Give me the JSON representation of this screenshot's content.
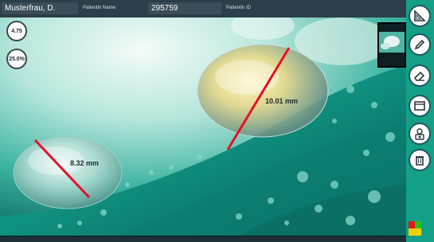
{
  "patient": {
    "name_value": "Musterfrau, D.",
    "name_caption": "Patientin Name",
    "id_value": "295759",
    "id_caption": "Patientin ID"
  },
  "overlay": {
    "zoom_label": "4.75",
    "percent_label": "25.0%"
  },
  "measurements": [
    {
      "label": "8.32 mm",
      "color": "#e8102a"
    },
    {
      "label": "10.01 mm",
      "color": "#e8102a"
    }
  ],
  "toolbar": {
    "tools": [
      {
        "icon": "ruler-triangle-icon"
      },
      {
        "icon": "pencil-icon"
      },
      {
        "icon": "eraser-icon"
      },
      {
        "icon": "window-icon"
      },
      {
        "icon": "camera-settings-icon"
      },
      {
        "icon": "trash-icon"
      }
    ],
    "swatches": [
      "#e81818",
      "#24c41c",
      "#f2d000",
      "#f2d000"
    ],
    "accent": "#14a086"
  }
}
